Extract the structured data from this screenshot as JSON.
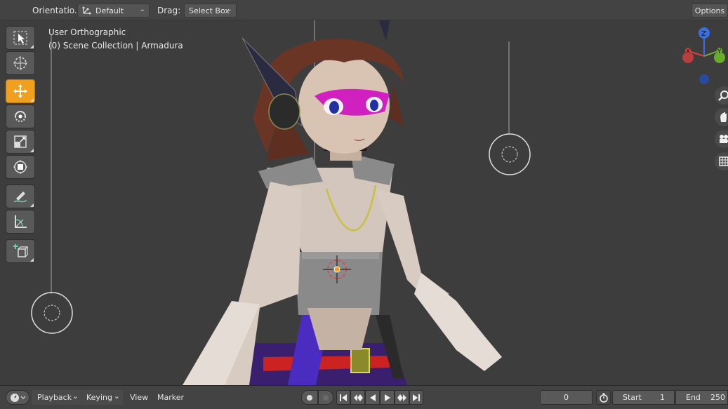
{
  "header": {
    "orientation_label": "Orientatio...",
    "orientation_value": "Default",
    "drag_label": "Drag:",
    "drag_value": "Select Box",
    "options_label": "Options"
  },
  "viewport": {
    "view_name": "User Orthographic",
    "collection": "(0) Scene Collection | Armadura"
  },
  "toolbar": {
    "tools": [
      "select-box-tool",
      "cursor-tool",
      "move-tool",
      "rotate-tool",
      "scale-tool",
      "transform-tool",
      "annotate-tool",
      "measure-tool",
      "add-cube-tool"
    ],
    "active": "move-tool"
  },
  "gizmo": {
    "axis_z": "Z",
    "axis_y": "Y",
    "axis_x": "X"
  },
  "timeline": {
    "playback_label": "Playback",
    "keying_label": "Keying",
    "view_label": "View",
    "marker_label": "Marker",
    "current_frame": "0",
    "start_label": "Start",
    "start_value": "1",
    "end_label": "End",
    "end_value": "250"
  },
  "colors": {
    "accent": "#f0a020",
    "background": "#3d3d3d",
    "panel": "#434343"
  }
}
